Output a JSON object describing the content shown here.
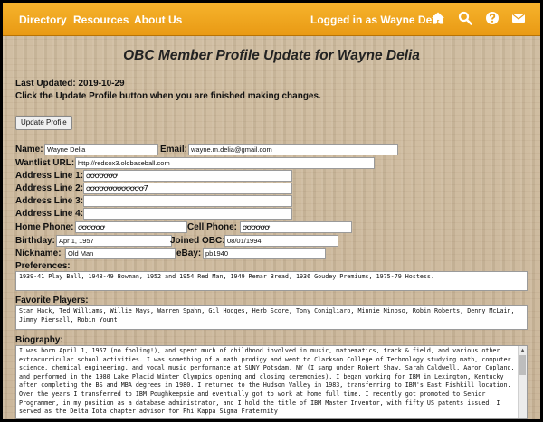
{
  "nav": {
    "directory": "Directory",
    "resources": "Resources",
    "about": "About Us",
    "logged_in": "Logged in as Wayne Delia",
    "icons": [
      "home-icon",
      "search-icon",
      "help-icon",
      "mail-icon"
    ]
  },
  "page": {
    "title": "OBC Member Profile Update for Wayne Delia",
    "last_updated": "Last Updated: 2019-10-29",
    "instructions": "Click the Update Profile button when you are finished making changes.",
    "update_button": "Update Profile"
  },
  "form": {
    "name_label": "Name:",
    "name_value": "Wayne Delia",
    "email_label": "Email:",
    "email_value": "wayne.m.delia@gmail.com",
    "wantlist_label": "Wantlist URL:",
    "wantlist_value": "http://redsox3.oldbaseball.com",
    "addr1_label": "Address Line 1:",
    "addr1_value": "ꝍꝍꝍꝍꝍꝍꝍ",
    "addr2_label": "Address Line 2:",
    "addr2_value": "ꝍꝍꝍꝍꝍꝍꝍꝍꝍꝍꝍꝍꝍ7",
    "addr3_label": "Address Line 3:",
    "addr3_value": "",
    "addr4_label": "Address Line 4:",
    "addr4_value": "",
    "home_phone_label": "Home Phone:",
    "home_phone_value": "ꝍꝍꝍꝍꝍꝍ",
    "cell_phone_label": "Cell Phone:",
    "cell_phone_value": "ꝍꝍꝍꝍꝍꝍ",
    "birthday_label": "Birthday:",
    "birthday_value": "Apr 1, 1957",
    "joined_label": "Joined OBC:",
    "joined_value": "08/01/1994",
    "nickname_label": "Nickname:",
    "nickname_value": "Old Man",
    "ebay_label": "eBay:",
    "ebay_value": "pb1940",
    "preferences_label": "Preferences:",
    "preferences_value": "1939-41 Play Ball, 1948-49 Bowman, 1952 and 1954 Red Man, 1949 Remar Bread, 1936 Goudey Premiums, 1975-79 Hostess.",
    "favorites_label": "Favorite Players:",
    "favorites_value": "Stan Hack, Ted Williams, Willie Mays, Warren Spahn, Gil Hodges, Herb Score, Tony Conigliaro, Minnie Minoso, Robin Roberts, Denny McLain, Jimmy Piersall, Robin Yount",
    "biography_label": "Biography:",
    "biography_value": "I was born April 1, 1957 (no fooling!), and spent much of childhood involved in music, mathematics, track & field, and various other extracurricular school activities. I was something of a math prodigy and went to Clarkson College of Technology studying math, computer science, chemical engineering, and vocal music performance at SUNY Potsdam, NY (I sang under Robert Shaw, Sarah Caldwell, Aaron Copland, and performed in the 1980 Lake Placid Winter Olympics opening and closing ceremonies). I began working for IBM in Lexington, Kentucky after completing the BS and MBA degrees in 1980. I returned to the Hudson Valley in 1983, transferring to IBM's East Fishkill location. Over the years I transferred to IBM Poughkeepsie and eventually got to work at home full time. I recently got promoted to Senior Programmer, in my position as a database administrator, and I hold the title of IBM Master Inventor, with fifty US patents issued. I served as the Delta Iota chapter advisor for Phi Kappa Sigma Fraternity"
  }
}
